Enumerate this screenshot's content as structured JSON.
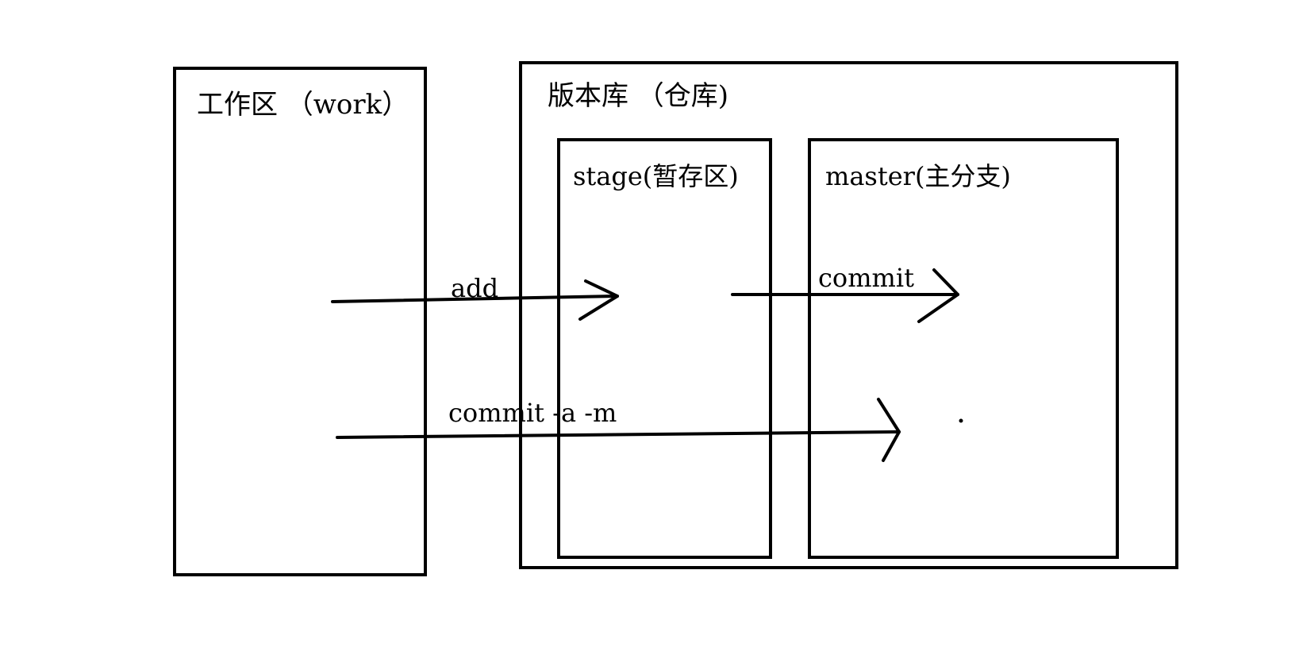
{
  "diagram": {
    "work_area": {
      "title": "工作区 （work）"
    },
    "repository": {
      "title": "版本库 （仓库)"
    },
    "stage": {
      "title": "stage(暂存区)"
    },
    "master": {
      "title": "master(主分支)"
    },
    "edges": [
      {
        "from": "work",
        "to": "stage",
        "label": "add"
      },
      {
        "from": "stage",
        "to": "master",
        "label": "commit"
      },
      {
        "from": "work",
        "to": "master",
        "label": "commit -a -m"
      }
    ]
  },
  "colors": {
    "stroke": "#000000",
    "background": "#ffffff"
  }
}
